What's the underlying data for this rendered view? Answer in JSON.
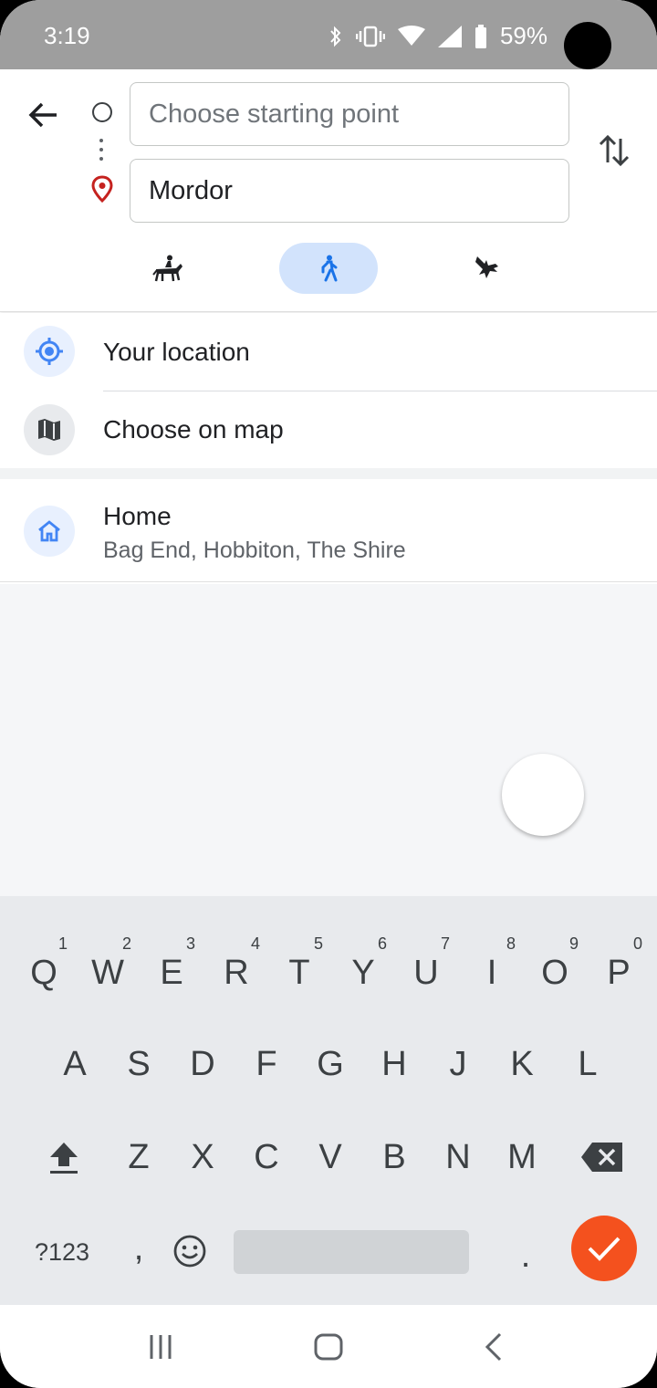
{
  "status_bar": {
    "time": "3:19",
    "battery": "59%"
  },
  "directions": {
    "start_placeholder": "Choose starting point",
    "destination_value": "Mordor",
    "modes": [
      {
        "icon": "horse-rider-icon",
        "selected": false
      },
      {
        "icon": "walking-icon",
        "selected": true
      },
      {
        "icon": "eagle-icon",
        "selected": false
      }
    ]
  },
  "suggestions": {
    "your_location": "Your location",
    "choose_on_map": "Choose on map",
    "home_title": "Home",
    "home_address": "Bag End, Hobbiton, The Shire"
  },
  "keyboard": {
    "row1": [
      "Q",
      "W",
      "E",
      "R",
      "T",
      "Y",
      "U",
      "I",
      "O",
      "P"
    ],
    "row1_nums": [
      "1",
      "2",
      "3",
      "4",
      "5",
      "6",
      "7",
      "8",
      "9",
      "0"
    ],
    "row2": [
      "A",
      "S",
      "D",
      "F",
      "G",
      "H",
      "J",
      "K",
      "L"
    ],
    "row3": [
      "Z",
      "X",
      "C",
      "V",
      "B",
      "N",
      "M"
    ],
    "symbols_key": "?123",
    "comma_key": ",",
    "period_key": "."
  },
  "colors": {
    "accent_blue": "#4285f4",
    "selected_mode_bg": "#d2e3fc",
    "pin_red": "#c5221f",
    "enter_orange": "#f4511e"
  }
}
